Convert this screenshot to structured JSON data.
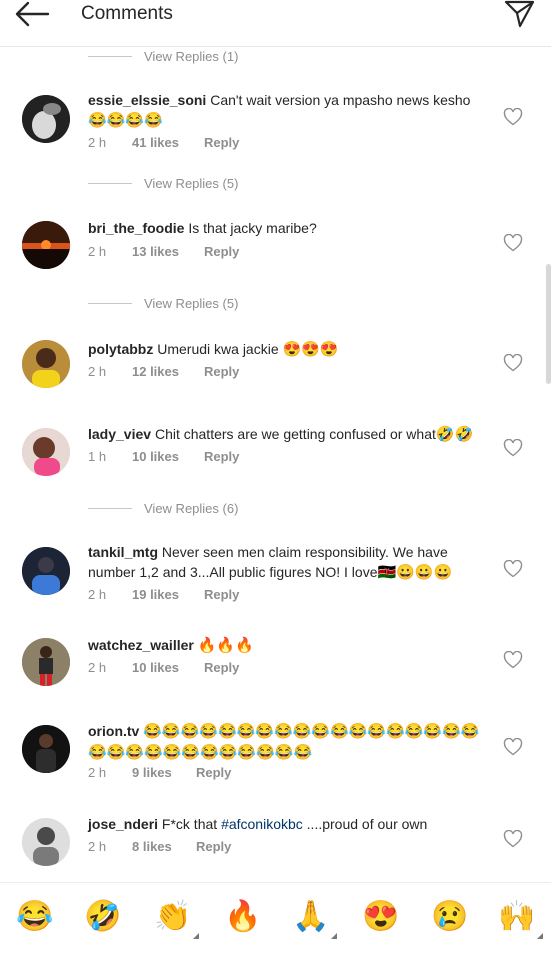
{
  "header": {
    "title": "Comments"
  },
  "view_replies": [
    "View Replies (1)",
    "View Replies (5)",
    "View Replies (5)",
    "View Replies (6)"
  ],
  "comments": [
    {
      "username": "essie_elssie_soni",
      "text": "Can't wait version ya mpasho news kesho",
      "emojis": "😂😂😂😂",
      "time": "2 h",
      "likes": "41 likes",
      "reply": "Reply"
    },
    {
      "username": "bri_the_foodie",
      "text": "Is that jacky maribe?",
      "emojis": "",
      "time": "2 h",
      "likes": "13 likes",
      "reply": "Reply"
    },
    {
      "username": "polytabbz",
      "text": "Umerudi kwa jackie",
      "emojis": "😍😍😍",
      "time": "2 h",
      "likes": "12 likes",
      "reply": "Reply"
    },
    {
      "username": "lady_viev",
      "text": "Chit chatters are we getting confused or what",
      "emojis": "🤣🤣",
      "time": "1 h",
      "likes": "10 likes",
      "reply": "Reply"
    },
    {
      "username": "tankil_mtg",
      "text": "Never seen men claim responsibility. We have number 1,2 and 3...All public figures NO! I love",
      "emojis": "🇰🇪😀😀😀",
      "time": "2 h",
      "likes": "19 likes",
      "reply": "Reply"
    },
    {
      "username": "watchez_wailler",
      "text": "",
      "emojis": "🔥🔥🔥",
      "time": "2 h",
      "likes": "10 likes",
      "reply": "Reply"
    },
    {
      "username": "orion.tv",
      "text": "",
      "emojis": "😂😂😂😂😂😂😂😂😂😂😂😂😂😂😂😂😂😂😂😂😂😂😂😂😂😂😂😂😂😂",
      "time": "2 h",
      "likes": "9 likes",
      "reply": "Reply"
    },
    {
      "username": "jose_nderi",
      "text": "F*ck that",
      "hashtag": "#afconikokbc",
      "text_after": "....proud of our own",
      "emojis": "",
      "time": "2 h",
      "likes": "8 likes",
      "reply": "Reply"
    }
  ],
  "emoji_bar": [
    "😂",
    "🤣",
    "👏",
    "🔥",
    "🙏",
    "😍",
    "😢",
    "🙌"
  ],
  "colors": {
    "hashtag": "#003569",
    "meta": "#8e8e8e"
  }
}
